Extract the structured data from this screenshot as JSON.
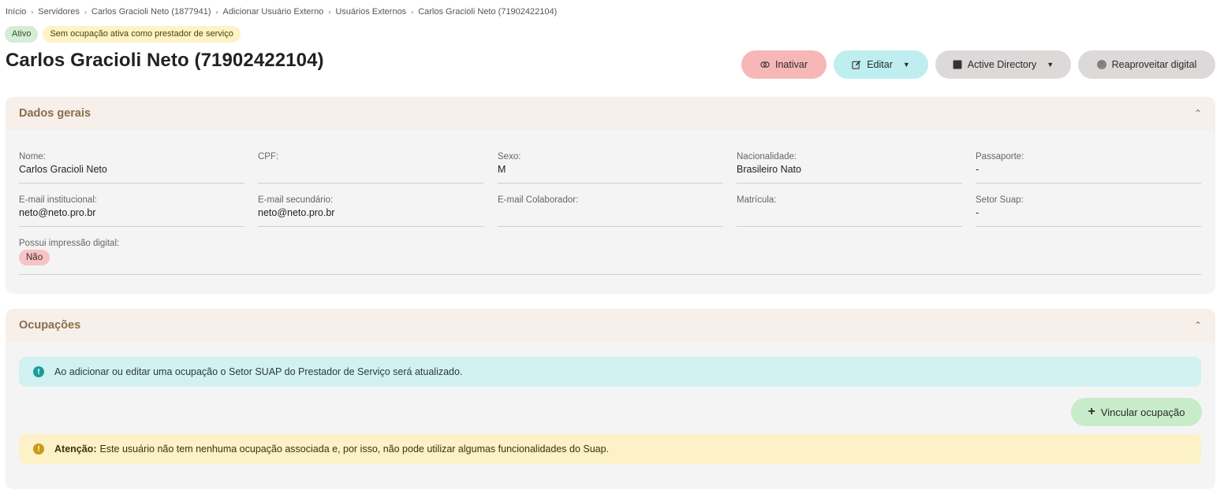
{
  "breadcrumb": [
    "Início",
    "Servidores",
    "Carlos Gracioli Neto (1877941)",
    "Adicionar Usuário Externo",
    "Usuários Externos",
    "Carlos Gracioli Neto (71902422104)"
  ],
  "status_badges": {
    "active": "Ativo",
    "no_occupation": "Sem ocupação ativa como prestador de serviço"
  },
  "page_title": "Carlos Gracioli Neto (71902422104)",
  "actions": {
    "inactivate": "Inativar",
    "edit": "Editar",
    "active_directory": "Active Directory",
    "reuse_fingerprint": "Reaproveitar digital"
  },
  "dados_gerais": {
    "title": "Dados gerais",
    "nome": {
      "label": "Nome:",
      "value": "Carlos Gracioli Neto"
    },
    "cpf": {
      "label": "CPF:",
      "value": ""
    },
    "sexo": {
      "label": "Sexo:",
      "value": "M"
    },
    "nacionalidade": {
      "label": "Nacionalidade:",
      "value": "Brasileiro Nato"
    },
    "passaporte": {
      "label": "Passaporte:",
      "value": "-"
    },
    "email_institucional": {
      "label": "E-mail institucional:",
      "value": "neto@neto.pro.br"
    },
    "email_secundario": {
      "label": "E-mail secundário:",
      "value": "neto@neto.pro.br"
    },
    "email_colaborador": {
      "label": "E-mail Colaborador:",
      "value": ""
    },
    "matricula": {
      "label": "Matrícula:",
      "value": ""
    },
    "setor_suap": {
      "label": "Setor Suap:",
      "value": "-"
    },
    "impressao_digital": {
      "label": "Possui impressão digital:",
      "value": "Não"
    }
  },
  "ocupacoes": {
    "title": "Ocupações",
    "info_text": "Ao adicionar ou editar uma ocupação o Setor SUAP do Prestador de Serviço será atualizado.",
    "link_button": "Vincular ocupação",
    "warning_strong": "Atenção:",
    "warning_text": "Este usuário não tem nenhuma ocupação associada e, por isso, não pode utilizar algumas funcionalidades do Suap."
  },
  "colors": {
    "panel_header_bg": "#f7efe9",
    "panel_title": "#8a6d4b",
    "inactivate_bg": "#f7b7b7",
    "edit_bg": "#bfeef0",
    "gray_btn_bg": "#dcd9d8",
    "info_bg": "#d1f2f1",
    "warning_bg": "#fcf1c7",
    "success_bg": "#c8ecc9"
  },
  "icons": {
    "inactivate": "toggle-icon",
    "edit": "edit-icon",
    "active_directory": "square-icon",
    "reuse_fingerprint": "fingerprint-icon",
    "info": "info-icon",
    "warning": "warning-icon",
    "add": "plus-icon",
    "collapse": "chevron-up-icon"
  }
}
